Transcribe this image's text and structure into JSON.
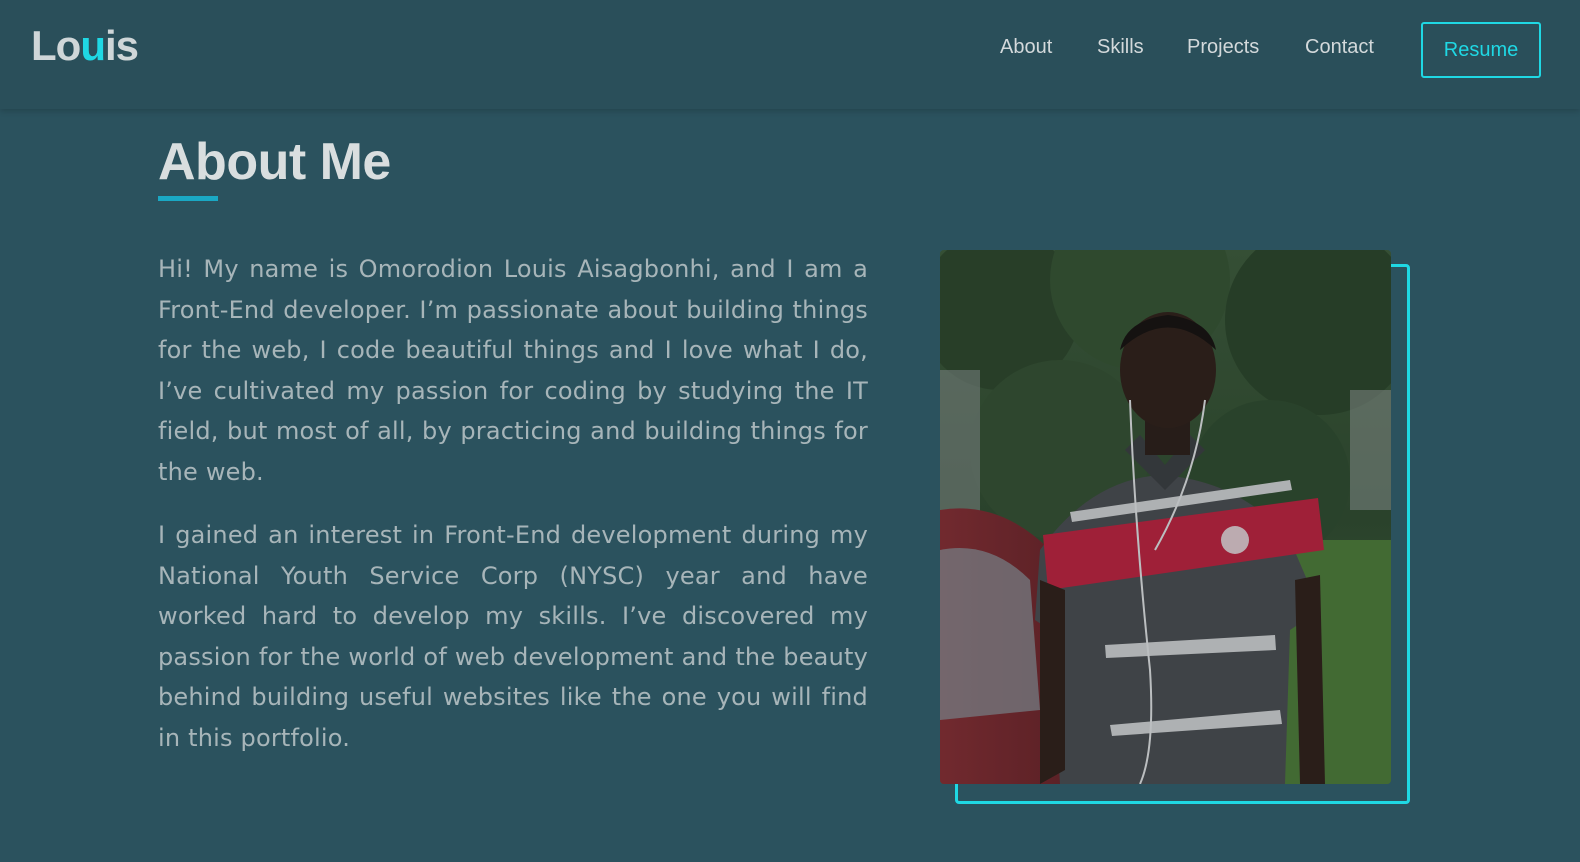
{
  "header": {
    "logo": {
      "prefix": "Lo",
      "accent": "u",
      "suffix": "is"
    },
    "nav": [
      {
        "label": "About"
      },
      {
        "label": "Skills"
      },
      {
        "label": "Projects"
      },
      {
        "label": "Contact"
      }
    ],
    "resume_label": "Resume"
  },
  "about": {
    "title": "About Me",
    "paragraphs": [
      "Hi! My name is Omorodion Louis Aisagbonhi, and I am a Front-End developer. I’m passionate about building things for the web, I code beautiful things and I love what I do, I’ve cultivated my passion for coding by studying the IT field, but most of all, by practicing and building things for the web.",
      "I gained an interest in Front-End development during my National Youth Service Corp (NYSC) year and have worked hard to develop my skills. I’ve discovered my passion for the world of web development and the beauty behind building useful websites like the one you will find in this portfolio."
    ]
  },
  "colors": {
    "background": "#2b525e",
    "navbar": "#2a4f5a",
    "accent": "#1fd8e4",
    "underline": "#1aa8c4",
    "text": "#a7b5b9",
    "heading": "#d9dedf"
  }
}
